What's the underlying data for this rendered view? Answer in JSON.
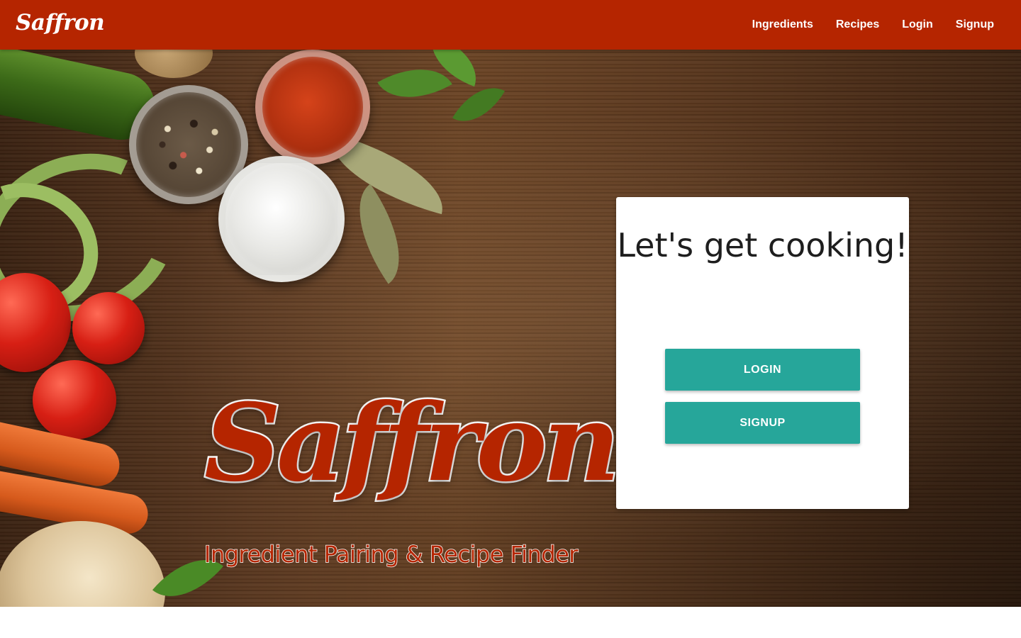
{
  "navbar": {
    "brand": "Saffron",
    "links": [
      "Ingredients",
      "Recipes",
      "Login",
      "Signup"
    ]
  },
  "hero": {
    "title": "Saffron",
    "subtitle": "Ingredient Pairing & Recipe Finder"
  },
  "card": {
    "heading": "Let's get cooking!",
    "login_label": "LOGIN",
    "signup_label": "SIGNUP"
  },
  "colors": {
    "brand_red": "#b52500",
    "button_teal": "#26a69a"
  }
}
